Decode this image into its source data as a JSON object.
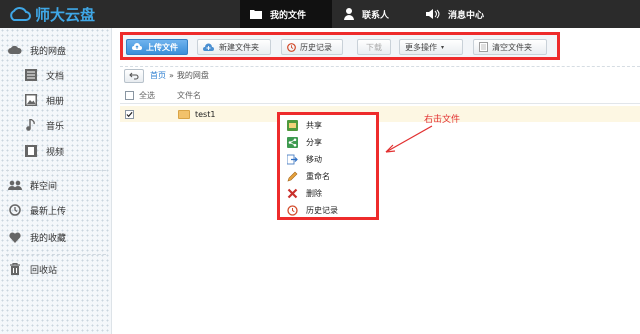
{
  "app": {
    "logo_text": "师大云盘"
  },
  "nav": {
    "items": [
      {
        "label": "我的文件",
        "icon": "folder-icon",
        "active": true
      },
      {
        "label": "联系人",
        "icon": "person-icon",
        "active": false
      },
      {
        "label": "消息中心",
        "icon": "speaker-icon",
        "active": false
      }
    ]
  },
  "sidebar": {
    "items": [
      {
        "label": "我的网盘",
        "icon": "cloud-icon"
      },
      {
        "label": "文档",
        "icon": "document-icon"
      },
      {
        "label": "相册",
        "icon": "image-icon"
      },
      {
        "label": "音乐",
        "icon": "music-icon"
      },
      {
        "label": "视频",
        "icon": "film-icon"
      },
      {
        "label": "群空间",
        "icon": "group-icon"
      },
      {
        "label": "最新上传",
        "icon": "clock-icon"
      },
      {
        "label": "我的收藏",
        "icon": "heart-icon"
      },
      {
        "label": "回收站",
        "icon": "trash-icon"
      }
    ]
  },
  "toolbar": {
    "upload": "上传文件",
    "new_folder": "新建文件夹",
    "history": "历史记录",
    "download": "下载",
    "more": "更多操作",
    "clear": "清空文件夹"
  },
  "breadcrumb": {
    "home": "首页",
    "separator": "»",
    "current": "我的网盘"
  },
  "table": {
    "select_all": "全选",
    "col_name": "文件名",
    "rows": [
      {
        "name": "test1",
        "checked": true
      }
    ]
  },
  "context_menu": {
    "items": [
      {
        "label": "共享",
        "icon": "share-folder-icon"
      },
      {
        "label": "分享",
        "icon": "share-icon"
      },
      {
        "label": "移动",
        "icon": "move-icon"
      },
      {
        "label": "重命名",
        "icon": "rename-icon"
      },
      {
        "label": "删除",
        "icon": "delete-icon"
      },
      {
        "label": "历史记录",
        "icon": "history-icon"
      }
    ]
  },
  "annotation": {
    "text": "右击文件"
  },
  "colors": {
    "accent": "#3b8fd9",
    "highlight": "#ee2b2b",
    "topbar": "#2b2b2b"
  }
}
